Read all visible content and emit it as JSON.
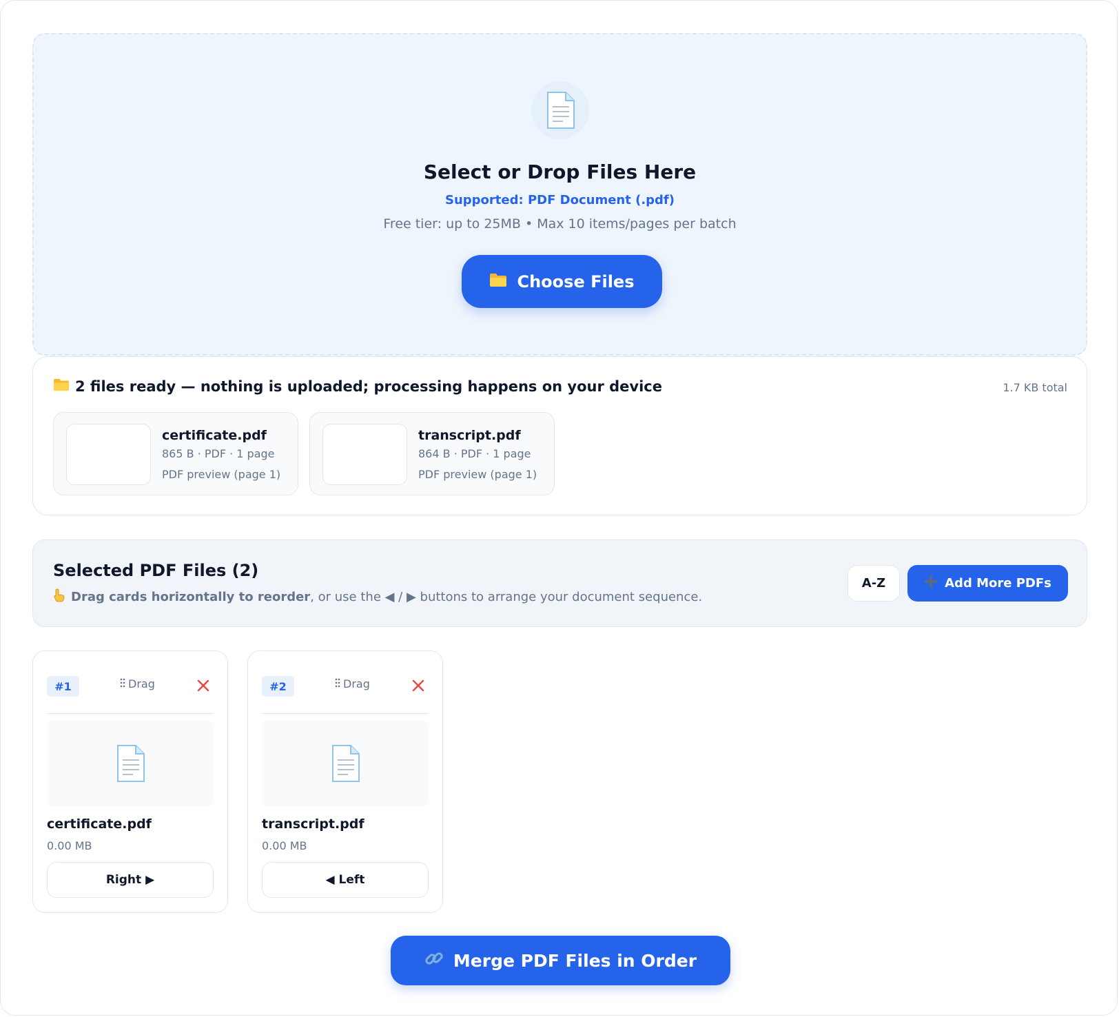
{
  "dropzone": {
    "title": "Select or Drop Files Here",
    "supported": "Supported: PDF Document (.pdf)",
    "limit": "Free tier: up to 25MB • Max 10 items/pages per batch",
    "choose_label": "Choose Files"
  },
  "ready": {
    "heading": "2 files ready — nothing is uploaded; processing happens on your device",
    "total": "1.7 KB total",
    "files": [
      {
        "name": "certificate.pdf",
        "meta": "865 B · PDF · 1 page",
        "preview": "PDF preview (page 1)"
      },
      {
        "name": "transcript.pdf",
        "meta": "864 B · PDF · 1 page",
        "preview": "PDF preview (page 1)"
      }
    ]
  },
  "selected": {
    "title": "Selected PDF Files (2)",
    "hint_bold": "Drag cards horizontally to reorder",
    "hint_rest": ", or use the ◀ / ▶ buttons to arrange your document sequence.",
    "az_label": "A-Z",
    "add_more_label": "Add More PDFs"
  },
  "order": [
    {
      "badge": "#1",
      "drag": "Drag",
      "name": "certificate.pdf",
      "size": "0.00 MB",
      "move_label": "Right ▶"
    },
    {
      "badge": "#2",
      "drag": "Drag",
      "name": "transcript.pdf",
      "size": "0.00 MB",
      "move_label": "◀ Left"
    }
  ],
  "merge_label": "Merge PDF Files in Order",
  "colors": {
    "accent": "#2563eb",
    "remove": "#ef4444",
    "folder": "#f5b82e"
  }
}
